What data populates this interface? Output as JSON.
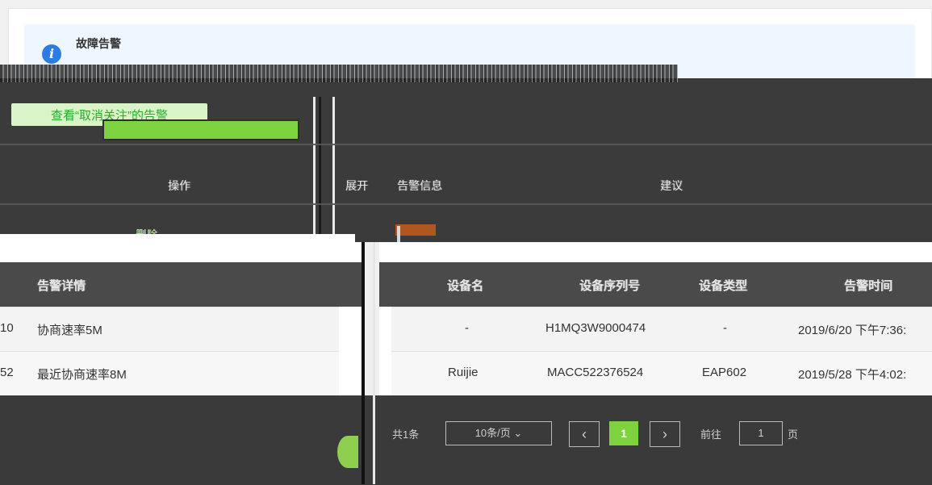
{
  "notice": {
    "icon": "info-icon",
    "title": "故障告警"
  },
  "filter": {
    "view_unfollowed": "查看“取消关注”的告警"
  },
  "upper_table": {
    "headers": {
      "operation": "操作",
      "expand": "展开",
      "alarm_info": "告警信息",
      "suggestion": "建议"
    },
    "row_action": "删除"
  },
  "alarm_table": {
    "headers": {
      "alarm_detail": "告警详情",
      "device_name": "设备名",
      "serial": "设备序列号",
      "device_type": "设备类型",
      "alarm_time": "告警时间"
    },
    "rows": [
      {
        "prefix": "10",
        "detail": "协商速率5M",
        "device_name": "-",
        "serial": "H1MQ3W9000474",
        "device_type": "-",
        "alarm_time": "2019/6/20 下午7:36:"
      },
      {
        "prefix": "52",
        "detail": "最近协商速率8M",
        "device_name": "Ruijie",
        "serial": "MACC522376524",
        "device_type": "EAP602",
        "alarm_time": "2019/5/28 下午4:02:"
      }
    ]
  },
  "pagination": {
    "total": "共1条",
    "page_size": "10条/页",
    "prev": "‹",
    "current": "1",
    "next": "›",
    "goto_prefix": "前往",
    "goto_value": "1",
    "goto_suffix": "页"
  },
  "colors": {
    "accent_green": "#7dd33f",
    "info_blue": "#2d7be5",
    "notice_bg": "#eef6ff"
  }
}
